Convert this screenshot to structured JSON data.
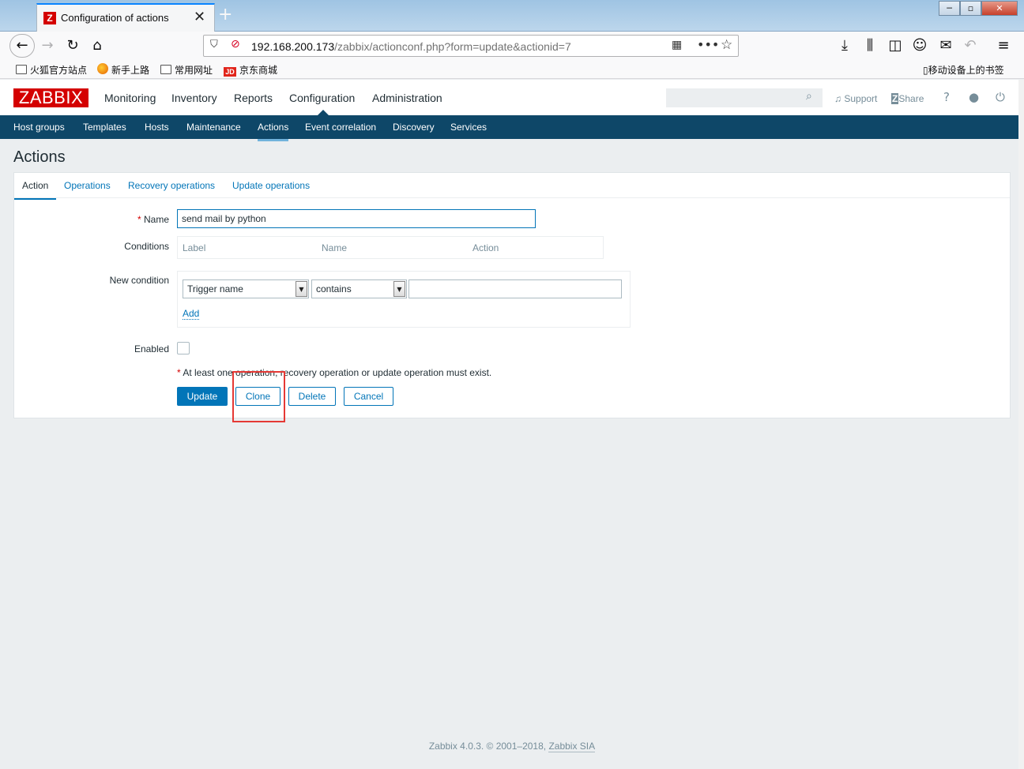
{
  "browser": {
    "tab_title": "Configuration of actions",
    "tab_favicon": "Z",
    "url_host": "192.168.200.173",
    "url_path": "/zabbix/actionconf.php?form=update&actionid=7",
    "bookmarks": [
      "火狐官方站点",
      "新手上路",
      "常用网址",
      "京东商城"
    ],
    "mobile_bookmarks": "移动设备上的书签"
  },
  "zabbix": {
    "logo": "ZABBIX",
    "top_menu": [
      "Monitoring",
      "Inventory",
      "Reports",
      "Configuration",
      "Administration"
    ],
    "selected_top_menu": "Configuration",
    "search_placeholder": "",
    "support_label": "Support",
    "share_label": "Share",
    "help_icon": "?",
    "sub_menu": [
      "Host groups",
      "Templates",
      "Hosts",
      "Maintenance",
      "Actions",
      "Event correlation",
      "Discovery",
      "Services"
    ],
    "selected_sub_menu": "Actions"
  },
  "page": {
    "title": "Actions",
    "tabs": [
      "Action",
      "Operations",
      "Recovery operations",
      "Update operations"
    ],
    "selected_tab": "Action",
    "form": {
      "name_label": "Name",
      "name_value": "send mail by python",
      "conditions_label": "Conditions",
      "conditions_headers": [
        "Label",
        "Name",
        "Action"
      ],
      "new_condition_label": "New condition",
      "condition_type": "Trigger name",
      "condition_operator": "contains",
      "condition_value": "",
      "add_label": "Add",
      "enabled_label": "Enabled",
      "enabled": false,
      "note": "At least one operation, recovery operation or update operation must exist.",
      "buttons": [
        "Update",
        "Clone",
        "Delete",
        "Cancel"
      ]
    }
  },
  "footer": {
    "text": "Zabbix 4.0.3. © 2001–2018, ",
    "link": "Zabbix SIA"
  },
  "colors": {
    "accent": "#0275b8",
    "nav_bg": "#0e4768",
    "logo_bg": "#d40000",
    "highlight": "#e53935"
  }
}
